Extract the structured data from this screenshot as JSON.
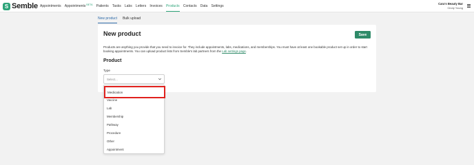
{
  "app": {
    "logo_mark": "S",
    "name": "Semble"
  },
  "nav": {
    "items": [
      {
        "label": "Appointments"
      },
      {
        "label": "Appointments",
        "badge": "BETA"
      },
      {
        "label": "Patients"
      },
      {
        "label": "Tasks"
      },
      {
        "label": "Labs"
      },
      {
        "label": "Letters"
      },
      {
        "label": "Invoices"
      },
      {
        "label": "Products"
      },
      {
        "label": "Contacts"
      },
      {
        "label": "Data"
      },
      {
        "label": "Settings"
      }
    ],
    "active": "Products"
  },
  "account": {
    "practice": "Cara's Beauty Bar",
    "user": "Cindy Young",
    "menu_icon": "hamburger-menu-icon"
  },
  "subtabs": [
    {
      "label": "New product",
      "active": true
    },
    {
      "label": "Bulk upload",
      "active": false
    }
  ],
  "form": {
    "title": "New product",
    "save_label": "Save",
    "description": "Products are anything you provide that you need to invoice for. They include appointments, labs, medications, and memberships. You must have at least one bookable product set up in order to start booking appointments. You can upload product lists from Semble's lab partners from the ",
    "description_link": "Lab settings page",
    "description_end": ".",
    "section_title": "Product",
    "type_label": "Type",
    "type_placeholder": "Select...",
    "type_options": [
      "Medication",
      "Vaccine",
      "Lab",
      "Membership",
      "Pathway",
      "Procedure",
      "Other",
      "Appointment"
    ],
    "highlighted_option": "Medication"
  },
  "colors": {
    "brand": "#2ea47a",
    "save_button": "#2e8a68",
    "highlight_border": "#e0201c",
    "tab_active": "#2e6aa8"
  }
}
